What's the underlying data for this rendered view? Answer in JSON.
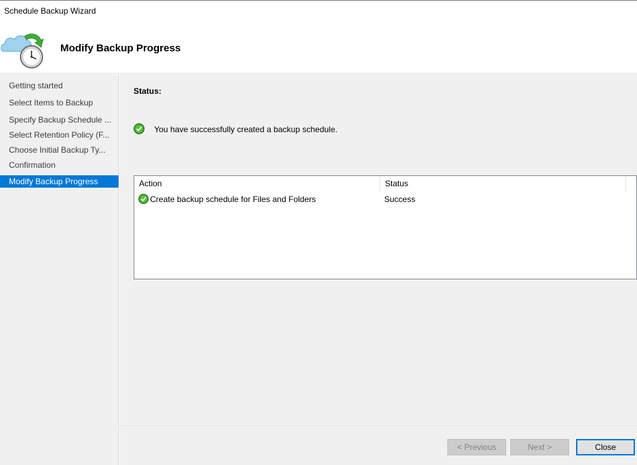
{
  "window": {
    "title": "Schedule Backup Wizard"
  },
  "header": {
    "title": "Modify Backup Progress",
    "icon": "cloud-clock-backup-icon"
  },
  "nav": {
    "items": [
      {
        "label": "Getting started",
        "active": false
      },
      {
        "label": "Select Items to Backup",
        "active": false
      },
      {
        "label": "Specify Backup Schedule ...",
        "active": false
      },
      {
        "label": "Select Retention Policy (F...",
        "active": false
      },
      {
        "label": "Choose Initial Backup Ty...",
        "active": false
      },
      {
        "label": "Confirmation",
        "active": false
      },
      {
        "label": "Modify Backup Progress",
        "active": true
      }
    ]
  },
  "content": {
    "status_label": "Status:",
    "success_message": "You have successfully created a backup schedule.",
    "table": {
      "columns": [
        "Action",
        "Status"
      ],
      "rows": [
        {
          "action": "Create backup schedule for Files and Folders",
          "status": "Success",
          "icon": "green-check-icon"
        }
      ]
    }
  },
  "footer": {
    "previous_label": "< Previous",
    "next_label": "Next >",
    "close_label": "Close"
  },
  "colors": {
    "accent": "#0078d7",
    "success": "#3c9a2a",
    "panel_bg": "#f0f0f0"
  }
}
